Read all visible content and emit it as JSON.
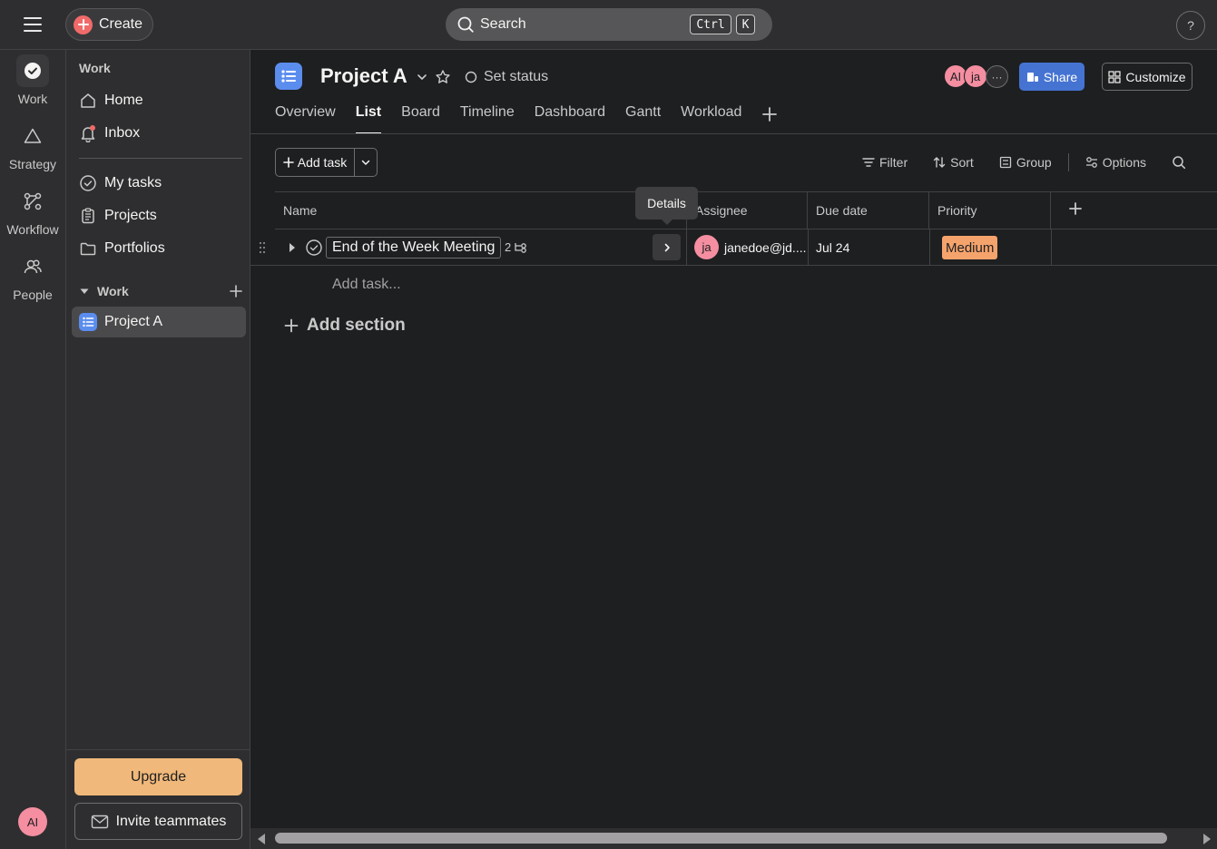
{
  "topbar": {
    "create_label": "Create",
    "search_placeholder": "Search",
    "shortcut_key1": "Ctrl",
    "shortcut_key2": "K",
    "help_label": "?"
  },
  "rail": {
    "items": [
      {
        "label": "Work",
        "icon": "check-circle-icon"
      },
      {
        "label": "Strategy",
        "icon": "triangle-icon"
      },
      {
        "label": "Workflow",
        "icon": "workflow-icon"
      },
      {
        "label": "People",
        "icon": "people-icon"
      }
    ],
    "user_initials": "AI"
  },
  "sidebar": {
    "heading": "Work",
    "items": [
      {
        "label": "Home",
        "icon": "home-icon"
      },
      {
        "label": "Inbox",
        "icon": "bell-icon"
      },
      {
        "label": "My tasks",
        "icon": "check-circle-icon"
      },
      {
        "label": "Projects",
        "icon": "clipboard-icon"
      },
      {
        "label": "Portfolios",
        "icon": "folder-icon"
      }
    ],
    "section_label": "Work",
    "project_label": "Project A",
    "upgrade_label": "Upgrade",
    "invite_label": "Invite teammates"
  },
  "project": {
    "title": "Project A",
    "set_status": "Set status",
    "members": [
      "AI",
      "ja"
    ],
    "more_label": "···",
    "share_label": "Share",
    "customize_label": "Customize",
    "tabs": [
      "Overview",
      "List",
      "Board",
      "Timeline",
      "Dashboard",
      "Gantt",
      "Workload"
    ],
    "active_tab": "List"
  },
  "toolbar": {
    "add_task_label": "Add task",
    "filter_label": "Filter",
    "sort_label": "Sort",
    "group_label": "Group",
    "options_label": "Options"
  },
  "table": {
    "columns": [
      "Name",
      "Assignee",
      "Due date",
      "Priority"
    ],
    "tooltip": "Details",
    "task": {
      "name": "End of the Week Meeting",
      "subtask_count": "2",
      "assignee_initials": "ja",
      "assignee": "janedoe@jd....",
      "due": "Jul 24",
      "priority": "Medium"
    },
    "add_task_inline": "Add task...",
    "add_section": "Add section"
  },
  "colors": {
    "accent_blue": "#4573d2",
    "create_red": "#f06a6a",
    "upgrade_orange": "#f0b87a",
    "priority_medium": "#f5a36c",
    "avatar_pink": "#f48ea0"
  }
}
